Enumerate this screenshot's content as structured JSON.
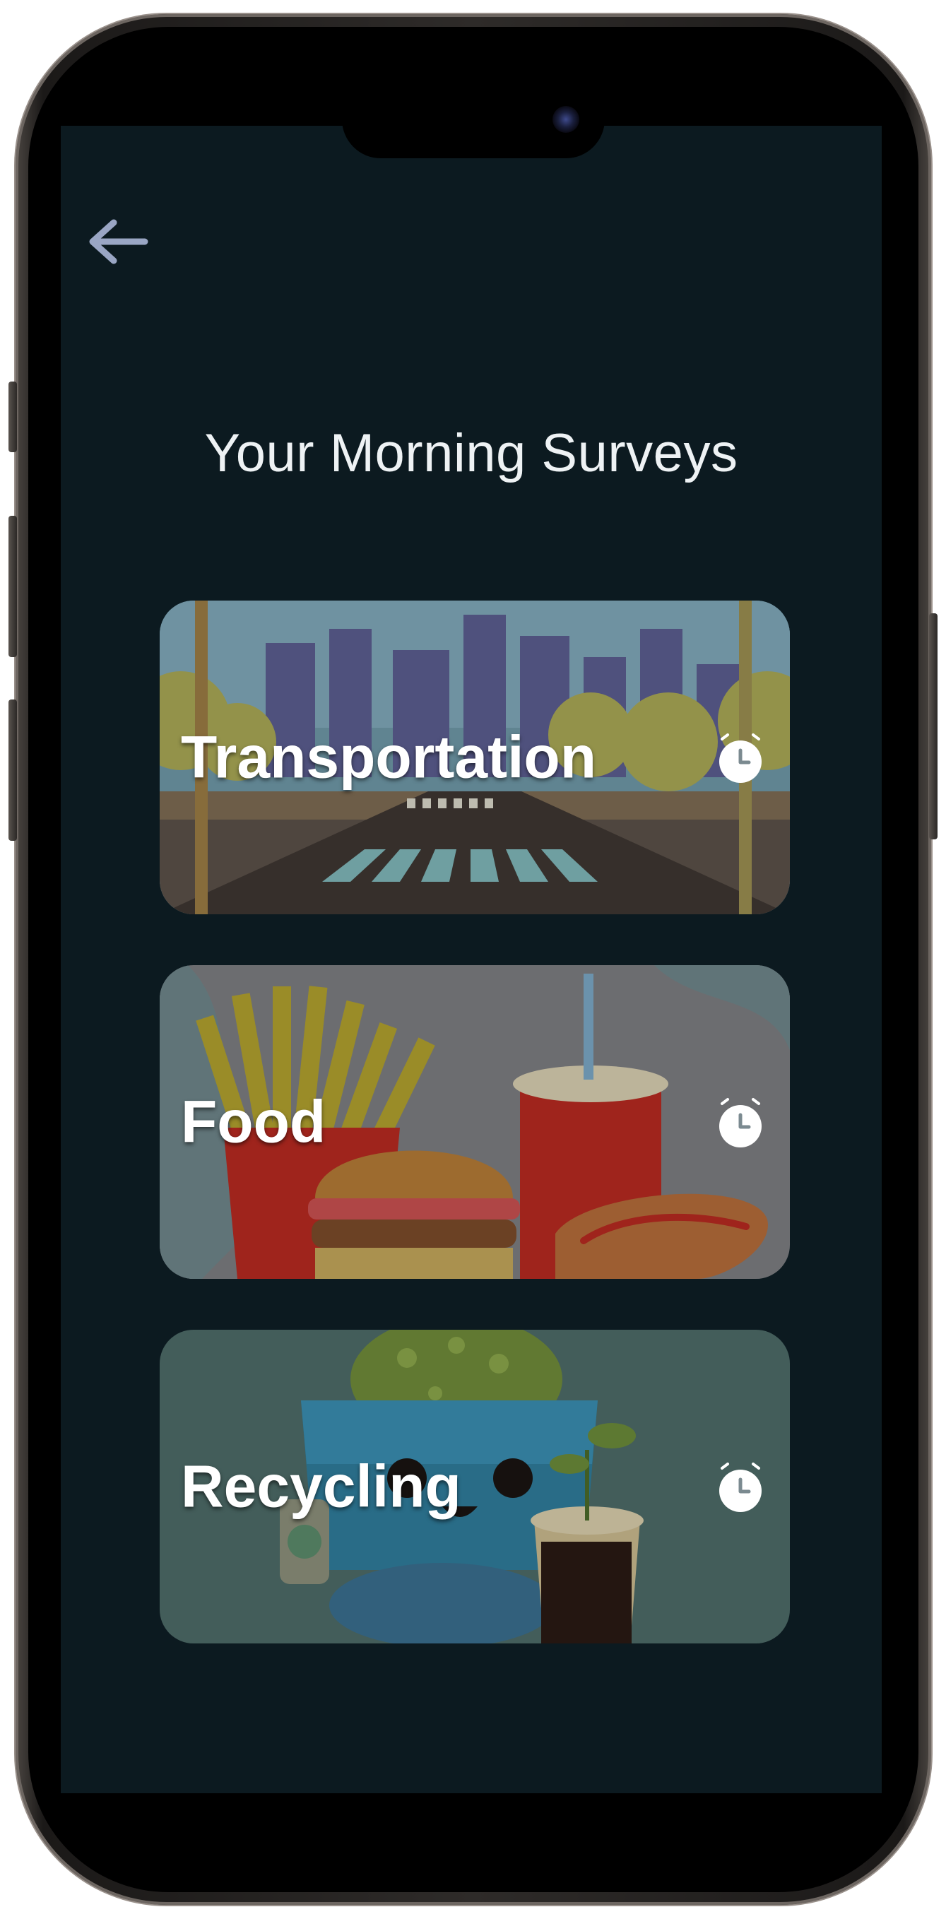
{
  "header": {
    "back_icon": "arrow-left-icon",
    "title": "Your Morning Surveys"
  },
  "surveys": [
    {
      "label": "Transportation",
      "icon": "alarm-clock-icon",
      "illustration": "city-street-crosswalk"
    },
    {
      "label": "Food",
      "icon": "alarm-clock-icon",
      "illustration": "fast-food-fries-burger-soda-hotdog"
    },
    {
      "label": "Recycling",
      "icon": "alarm-clock-icon",
      "illustration": "recycling-bin-character-with-plant-cup"
    }
  ],
  "colors": {
    "screen_background": "#0c1a20",
    "title_text": "#eef2f4",
    "back_arrow": "#9aa6c4",
    "card_label": "#ffffff"
  }
}
